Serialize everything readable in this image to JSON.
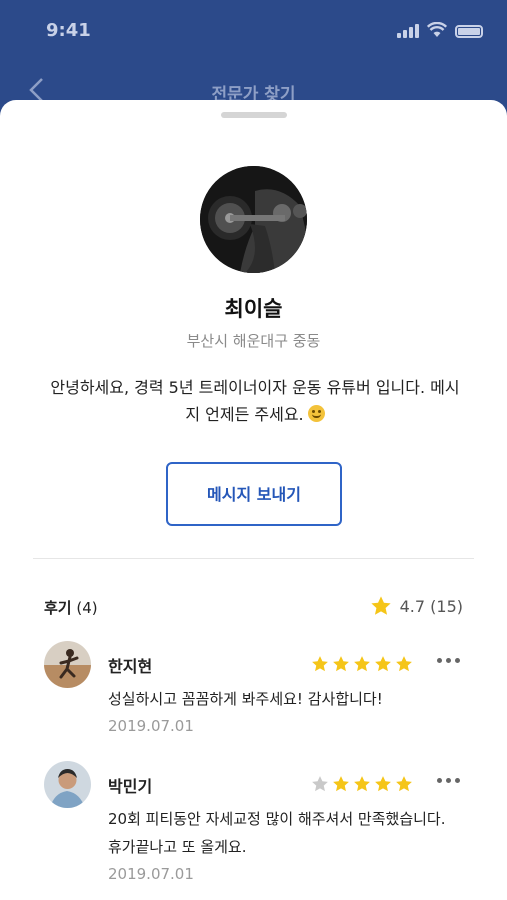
{
  "status": {
    "time": "9:41"
  },
  "nav": {
    "title": "전문가 찾기"
  },
  "profile": {
    "name": "최이슬",
    "location": "부산시 해운대구 중동",
    "bio": "안녕하세요, 경력 5년 트레이너이자 운동 유튜버 입니다. 메시지 언제든 주세요."
  },
  "actions": {
    "message_label": "메시지 보내기"
  },
  "reviews": {
    "title_label": "후기",
    "count_text": "(4)",
    "rating_text": "4.7 (15)",
    "star_color": "#f5c518",
    "empty_star_color": "#c9c9c9",
    "items": [
      {
        "name": "한지현",
        "stars": 5,
        "text": "성실하시고 꼼꼼하게 봐주세요! 감사합니다!",
        "date": "2019.07.01"
      },
      {
        "name": "박민기",
        "stars": 4,
        "text": "20회 피티동안 자세교정 많이 해주셔서 만족했습니다. 휴가끝나고 또 올게요.",
        "date": "2019.07.01"
      }
    ]
  }
}
